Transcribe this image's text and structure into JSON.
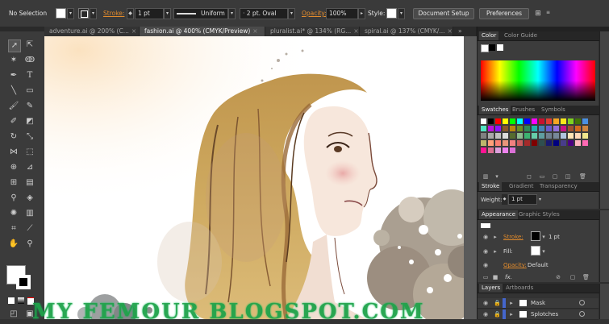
{
  "control_bar": {
    "selection": "No Selection",
    "stroke_label": "Stroke:",
    "stroke_weight": "1 pt",
    "profile": "Uniform",
    "brush": "2 pt. Oval",
    "opacity_label": "Opacity:",
    "opacity_value": "100%",
    "style_label": "Style:",
    "doc_setup": "Document Setup",
    "preferences": "Preferences"
  },
  "tabs": [
    {
      "label": "adventure.ai @ 200% (C...",
      "close": "×"
    },
    {
      "label": "fashion.ai @ 400% (CMYK/Preview)",
      "close": "×"
    },
    {
      "label": "pluralist.ai* @ 134% (RG...",
      "close": "×"
    },
    {
      "label": "spiral.ai @ 137% (CMYK/...",
      "close": "×"
    }
  ],
  "color_panel": {
    "tabs": [
      "Color",
      "Color Guide"
    ]
  },
  "swatches_panel": {
    "tabs": [
      "Swatches",
      "Brushes",
      "Symbols"
    ]
  },
  "stroke_panel": {
    "tabs": [
      "Stroke",
      "Gradient",
      "Transparency"
    ],
    "weight_label": "Weight:",
    "weight_value": "1 pt"
  },
  "appearance_panel": {
    "tabs": [
      "Appearance",
      "Graphic Styles"
    ],
    "stroke_label": "Stroke:",
    "stroke_value": "1 pt",
    "fill_label": "Fill:",
    "opacity_label": "Opacity:",
    "opacity_value": "Default",
    "fx": "fx."
  },
  "layers_panel": {
    "tabs": [
      "Layers",
      "Artboards"
    ],
    "layers": [
      "Mask",
      "Splotches"
    ]
  },
  "watermark": "MY FEMOUR BLOGSPOT.COM",
  "colors": {
    "accent": "#e08a2c",
    "panel": "#3c3c3c",
    "watermark": "#1fa34a"
  }
}
